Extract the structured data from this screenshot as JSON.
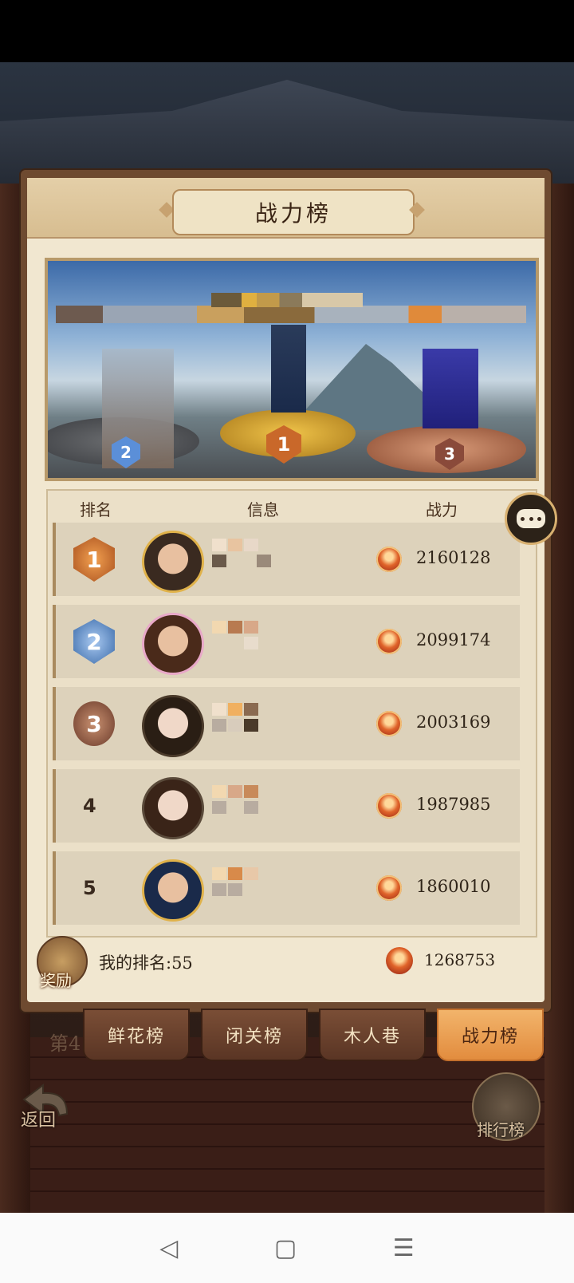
{
  "panel": {
    "title": "战力榜"
  },
  "podium": {
    "ranks": [
      "2",
      "1",
      "3"
    ]
  },
  "table": {
    "headers": {
      "rank": "排名",
      "info": "信息",
      "power": "战力"
    },
    "rows": [
      {
        "rank": "1",
        "power": "2160128"
      },
      {
        "rank": "2",
        "power": "2099174"
      },
      {
        "rank": "3",
        "power": "2003169"
      },
      {
        "rank": "4",
        "power": "1987985"
      },
      {
        "rank": "5",
        "power": "1860010"
      }
    ]
  },
  "my_rank": {
    "label": "我的排名:55",
    "power": "1268753",
    "reward_label": "奖励"
  },
  "tabs": [
    {
      "label": "鲜花榜",
      "active": false
    },
    {
      "label": "闭关榜",
      "active": false
    },
    {
      "label": "木人巷",
      "active": false
    },
    {
      "label": "战力榜",
      "active": true
    }
  ],
  "background_text": "第4",
  "buttons": {
    "back_label": "返回",
    "leaderboard_label": "排行榜"
  },
  "nav": {
    "back_icon": "◁",
    "home_icon": "▢",
    "menu_icon": "☰"
  },
  "colors": {
    "panel_bg": "#f1e7d0",
    "tab_active": "#e28c3e",
    "gold": "#e0b24a"
  }
}
